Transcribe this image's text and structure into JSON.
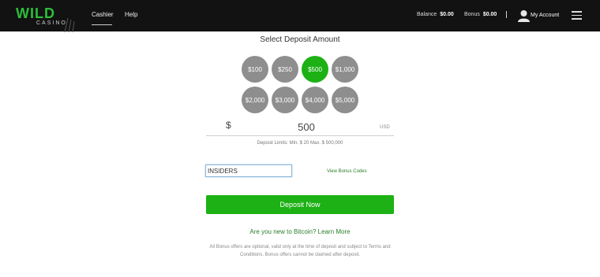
{
  "header": {
    "logo_main": "WILD",
    "logo_sub": "CASINO",
    "nav": {
      "cashier": "Cashier",
      "help": "Help"
    },
    "balance_label": "Balance",
    "balance_value": "$0.00",
    "bonus_label": "Bonus",
    "bonus_value": "$0.00",
    "account_label": "My Account"
  },
  "deposit": {
    "title": "Select Deposit Amount",
    "amounts": [
      "$100",
      "$250",
      "$500",
      "$1,000",
      "$2,000",
      "$3,000",
      "$4,000",
      "$5,000"
    ],
    "selected_amount": "$500",
    "currency_symbol": "$",
    "amount_value": "500",
    "currency_code": "USD",
    "limits": "Deposit Limits: Min. $ 20    Max. $ 500,000",
    "bonus_code_value": "INSIDERS",
    "view_codes_link": "View Bonus Codes",
    "submit_label": "Deposit Now",
    "bitcoin_link": "Are you new to Bitcoin? Learn More",
    "disclaimer": "All Bonus offers are optional, valid only at the time of deposit and subject to Terms and Conditions. Bonus offers cannot be claimed after deposit."
  },
  "colors": {
    "accent": "#1db115",
    "header_bg": "#121212",
    "chip": "#8e8e8e"
  }
}
